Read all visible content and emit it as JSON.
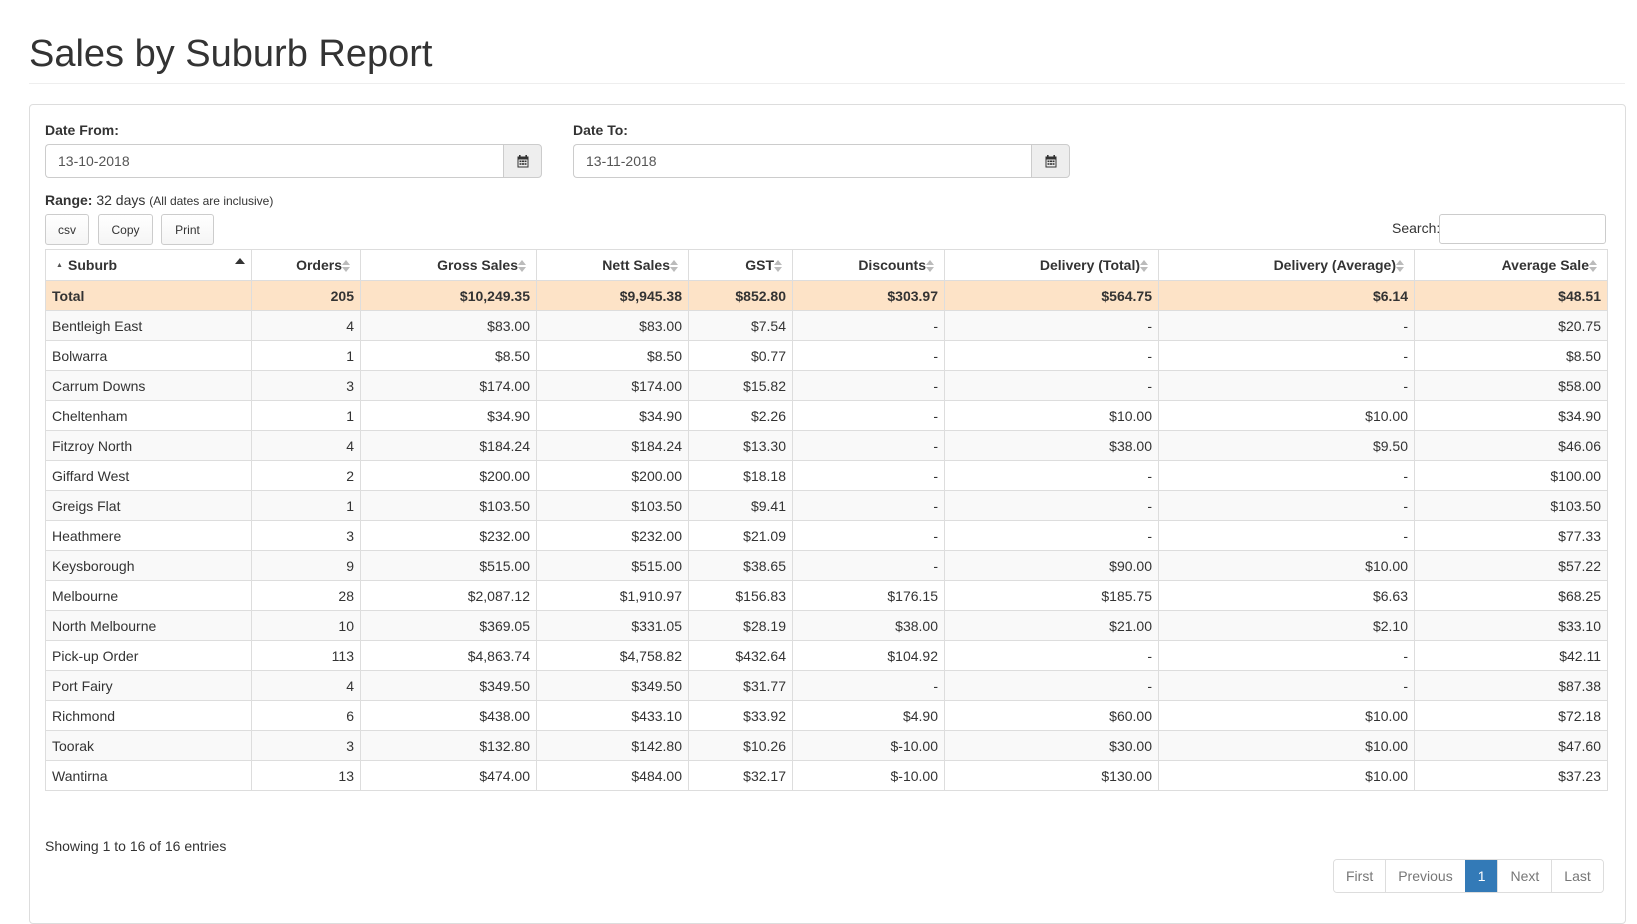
{
  "page": {
    "title": "Sales by Suburb Report"
  },
  "filters": {
    "date_from_label": "Date From:",
    "date_from_value": "13-10-2018",
    "date_to_label": "Date To:",
    "date_to_value": "13-11-2018",
    "range_label": "Range:",
    "range_value": "32 days",
    "range_note": "(All dates are inclusive)"
  },
  "toolbar": {
    "csv_label": "csv",
    "copy_label": "Copy",
    "print_label": "Print",
    "search_label": "Search:"
  },
  "table": {
    "columns": [
      "Suburb",
      "Orders",
      "Gross Sales",
      "Nett Sales",
      "GST",
      "Discounts",
      "Delivery (Total)",
      "Delivery (Average)",
      "Average Sale"
    ],
    "total": [
      "Total",
      "205",
      "$10,249.35",
      "$9,945.38",
      "$852.80",
      "$303.97",
      "$564.75",
      "$6.14",
      "$48.51"
    ],
    "rows": [
      [
        "Bentleigh East",
        "4",
        "$83.00",
        "$83.00",
        "$7.54",
        "-",
        "-",
        "-",
        "$20.75"
      ],
      [
        "Bolwarra",
        "1",
        "$8.50",
        "$8.50",
        "$0.77",
        "-",
        "-",
        "-",
        "$8.50"
      ],
      [
        "Carrum Downs",
        "3",
        "$174.00",
        "$174.00",
        "$15.82",
        "-",
        "-",
        "-",
        "$58.00"
      ],
      [
        "Cheltenham",
        "1",
        "$34.90",
        "$34.90",
        "$2.26",
        "-",
        "$10.00",
        "$10.00",
        "$34.90"
      ],
      [
        "Fitzroy North",
        "4",
        "$184.24",
        "$184.24",
        "$13.30",
        "-",
        "$38.00",
        "$9.50",
        "$46.06"
      ],
      [
        "Giffard West",
        "2",
        "$200.00",
        "$200.00",
        "$18.18",
        "-",
        "-",
        "-",
        "$100.00"
      ],
      [
        "Greigs Flat",
        "1",
        "$103.50",
        "$103.50",
        "$9.41",
        "-",
        "-",
        "-",
        "$103.50"
      ],
      [
        "Heathmere",
        "3",
        "$232.00",
        "$232.00",
        "$21.09",
        "-",
        "-",
        "-",
        "$77.33"
      ],
      [
        "Keysborough",
        "9",
        "$515.00",
        "$515.00",
        "$38.65",
        "-",
        "$90.00",
        "$10.00",
        "$57.22"
      ],
      [
        "Melbourne",
        "28",
        "$2,087.12",
        "$1,910.97",
        "$156.83",
        "$176.15",
        "$185.75",
        "$6.63",
        "$68.25"
      ],
      [
        "North Melbourne",
        "10",
        "$369.05",
        "$331.05",
        "$28.19",
        "$38.00",
        "$21.00",
        "$2.10",
        "$33.10"
      ],
      [
        "Pick-up Order",
        "113",
        "$4,863.74",
        "$4,758.82",
        "$432.64",
        "$104.92",
        "-",
        "-",
        "$42.11"
      ],
      [
        "Port Fairy",
        "4",
        "$349.50",
        "$349.50",
        "$31.77",
        "-",
        "-",
        "-",
        "$87.38"
      ],
      [
        "Richmond",
        "6",
        "$438.00",
        "$433.10",
        "$33.92",
        "$4.90",
        "$60.00",
        "$10.00",
        "$72.18"
      ],
      [
        "Toorak",
        "3",
        "$132.80",
        "$142.80",
        "$10.26",
        "$-10.00",
        "$30.00",
        "$10.00",
        "$47.60"
      ],
      [
        "Wantirna",
        "13",
        "$474.00",
        "$484.00",
        "$32.17",
        "$-10.00",
        "$130.00",
        "$10.00",
        "$37.23"
      ]
    ]
  },
  "footer": {
    "info": "Showing 1 to 16 of 16 entries",
    "pagination": [
      "First",
      "Previous",
      "1",
      "Next",
      "Last"
    ],
    "active_page": "1"
  },
  "colors": {
    "total_row": "#fde3c7",
    "active_page": "#337ab7"
  }
}
